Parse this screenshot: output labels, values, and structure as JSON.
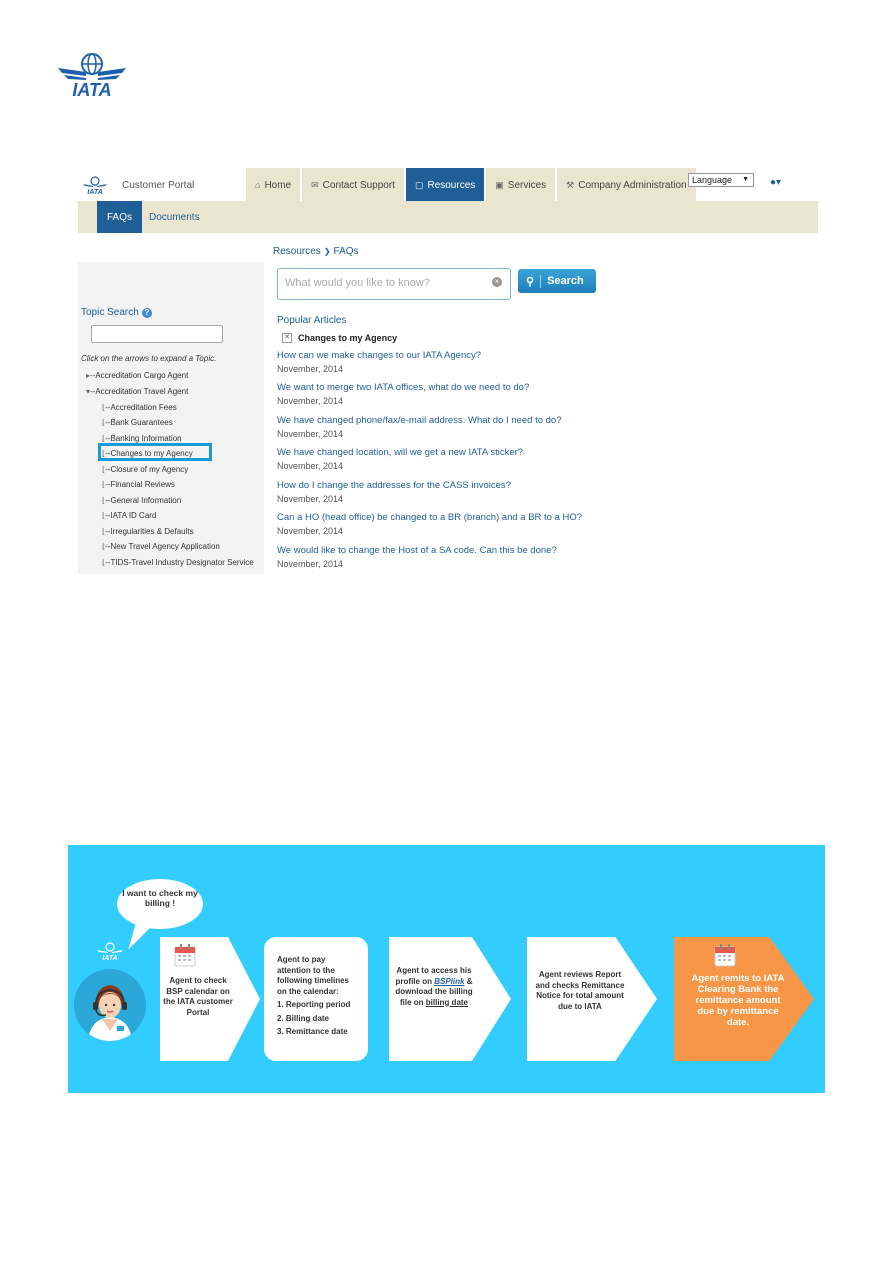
{
  "navbar": {
    "brand": "Customer Portal",
    "tabs": [
      {
        "label": "Home",
        "icon": "home-icon"
      },
      {
        "label": "Contact Support",
        "icon": "envelope-icon"
      },
      {
        "label": "Resources",
        "icon": "book-icon",
        "active": true
      },
      {
        "label": "Services",
        "icon": "briefcase-icon"
      },
      {
        "label": "Company Administration",
        "icon": "wrench-icon"
      }
    ],
    "language": "Language",
    "user_icon": "user-icon"
  },
  "subnav": {
    "tabs": [
      {
        "label": "FAQs",
        "active": true
      },
      {
        "label": "Documents"
      }
    ]
  },
  "breadcrumb": {
    "parent": "Resources",
    "current": "FAQs"
  },
  "sidebar": {
    "topic_search_label": "Topic Search",
    "hint": "Click on the arrows to expand a Topic.",
    "tree": [
      "--Accreditation Cargo Agent",
      "--Accreditation Travel Agent",
      "--Accreditation Fees",
      "--Bank Guarantees",
      "--Banking Information",
      "--Changes to my Agency",
      "--Closure of my Agency",
      "--Financial Reviews",
      "--General Information",
      "--IATA ID Card",
      "--Irregularities & Defaults",
      "--New Travel Agency Application",
      "--TIDS-Travel Industry Designator Service"
    ]
  },
  "search": {
    "placeholder": "What would you like to know?",
    "button": "Search"
  },
  "popular": {
    "title": "Popular Articles",
    "category": "Changes to my Agency",
    "articles": [
      {
        "q": "How can we make changes to our IATA Agency?",
        "date": "November, 2014"
      },
      {
        "q": "We want to merge two IATA offices, what do we need to do?",
        "date": "November, 2014"
      },
      {
        "q": "We have changed phone/fax/e-mail address. What do I need to do?",
        "date": "November, 2014"
      },
      {
        "q": "We have changed location, will we get a new IATA sticker?",
        "date": "November, 2014"
      },
      {
        "q": "How do I change the addresses for the CASS invoices?",
        "date": "November, 2014"
      },
      {
        "q": "Can a HO (head office) be changed to a BR (branch) and a BR to a HO?",
        "date": "November, 2014"
      },
      {
        "q": "We would like to change the Host of a SA code. Can this be done?",
        "date": "November, 2014"
      }
    ]
  },
  "infographic": {
    "bubble": "I want to check my billing !",
    "step1": "Agent to check BSP calendar on the IATA customer Portal",
    "step2_intro": "Agent to pay attention to the following timelines on the calendar:",
    "step2_items": [
      "1. Reporting period",
      "2. Billing date",
      "3. Remittance date"
    ],
    "step3_a": "Agent to access his profile on",
    "step3_link": "BSPlink",
    "step3_b": "& download the billing file on",
    "step3_c": "billing date",
    "step4": "Agent reviews Report and checks Remittance Notice for total amount due to IATA",
    "step5": "Agent remits to IATA Clearing Bank the remittance amount due by remittance date.",
    "colors": {
      "background": "#33ccff",
      "highlight": "#f79646"
    }
  },
  "logo_text": "IATA"
}
